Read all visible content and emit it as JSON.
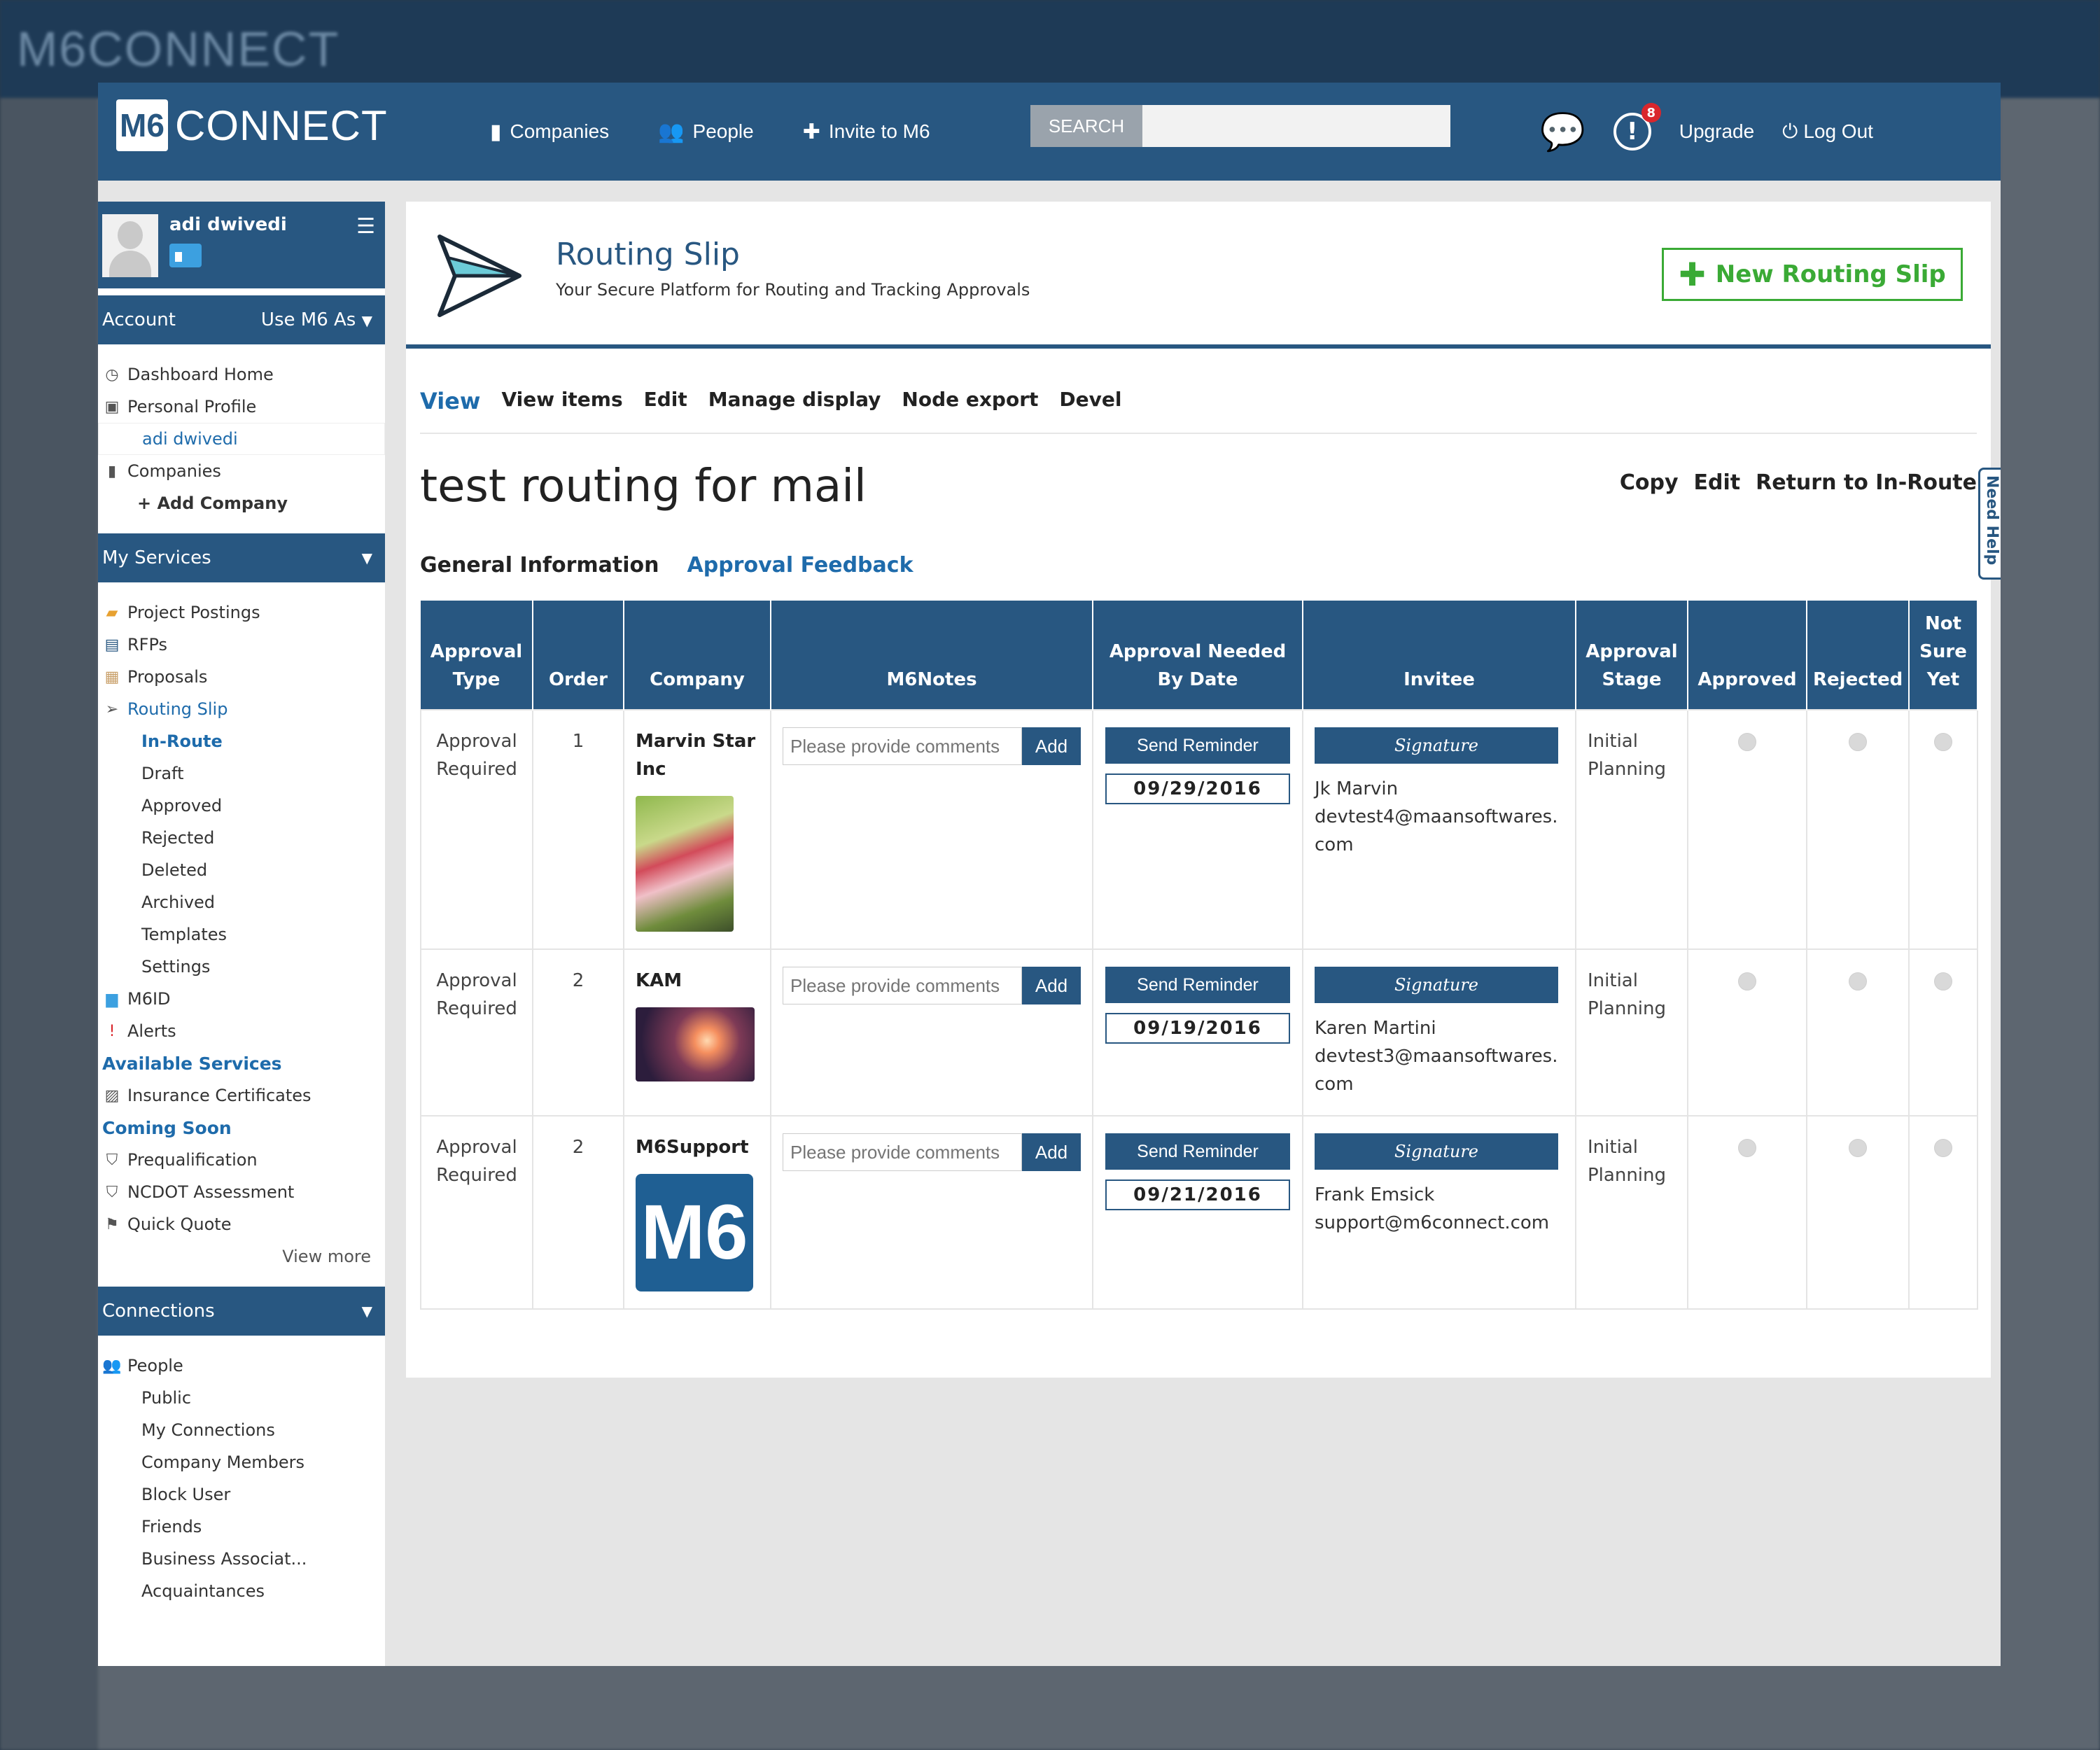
{
  "app": {
    "logo_mark": "M6",
    "logo_text": "CONNECT"
  },
  "topbar": {
    "nav": [
      {
        "label": "Companies",
        "icon": "building-icon"
      },
      {
        "label": "People",
        "icon": "people-icon"
      },
      {
        "label": "Invite to M6",
        "icon": "plus-icon"
      }
    ],
    "search_label": "SEARCH",
    "search_placeholder": "",
    "alert_count": "8",
    "upgrade": "Upgrade",
    "logout": "Log Out"
  },
  "sidebar": {
    "user_name": "adi dwivedi",
    "account_head": "Account",
    "use_as": "Use M6 As",
    "account_items": [
      "Dashboard Home",
      "Personal Profile",
      "adi dwivedi",
      "Companies",
      "+ Add Company"
    ],
    "services_head": "My Services",
    "services_items": [
      "Project Postings",
      "RFPs",
      "Proposals",
      "Routing Slip",
      "In-Route",
      "Draft",
      "Approved",
      "Rejected",
      "Deleted",
      "Archived",
      "Templates",
      "Settings",
      "M6ID",
      "Alerts"
    ],
    "available_head": "Available Services",
    "available_items": [
      "Insurance Certificates"
    ],
    "coming_head": "Coming Soon",
    "coming_items": [
      "Prequalification",
      "NCDOT Assessment",
      "Quick Quote"
    ],
    "view_more": "View more",
    "connections_head": "Connections",
    "connections_items": [
      "People",
      "Public",
      "My Connections",
      "Company Members",
      "Block User",
      "Friends",
      "Business Associat...",
      "Acquaintances"
    ]
  },
  "header": {
    "title": "Routing Slip",
    "subtitle": "Your Secure Platform for Routing and Tracking Approvals",
    "new_button": "New Routing Slip"
  },
  "tabs": [
    "View",
    "View items",
    "Edit",
    "Manage display",
    "Node export",
    "Devel"
  ],
  "node": {
    "title": "test routing for mail",
    "actions": [
      "Copy",
      "Edit",
      "Return to In-Route"
    ]
  },
  "subtabs": {
    "general": "General Information",
    "feedback": "Approval Feedback"
  },
  "table": {
    "headers": [
      "Approval Type",
      "Order",
      "Company",
      "M6Notes",
      "Approval Needed By Date",
      "Invitee",
      "Approval Stage",
      "Approved",
      "Rejected",
      "Not Sure Yet"
    ],
    "notes_placeholder": "Please provide comments",
    "add_label": "Add",
    "reminder_label": "Send Reminder",
    "signature_label": "Signature",
    "rows": [
      {
        "type": "Approval Required",
        "order": "1",
        "company": "Marvin Star Inc",
        "date": "09/29/2016",
        "invitee_name": "Jk Marvin",
        "invitee_email": "devtest4@maansoftwares.com",
        "stage": "Initial Planning"
      },
      {
        "type": "Approval Required",
        "order": "2",
        "company": "KAM",
        "date": "09/19/2016",
        "invitee_name": "Karen Martini",
        "invitee_email": "devtest3@maansoftwares.com",
        "stage": "Initial Planning"
      },
      {
        "type": "Approval Required",
        "order": "2",
        "company": "M6Support",
        "date": "09/21/2016",
        "invitee_name": "Frank Emsick",
        "invitee_email": "support@m6connect.com",
        "stage": "Initial Planning"
      }
    ]
  },
  "need_help": "Need Help",
  "colors": {
    "primary": "#285781",
    "accent_green": "#3aaa35",
    "link_blue": "#1e6bab"
  }
}
